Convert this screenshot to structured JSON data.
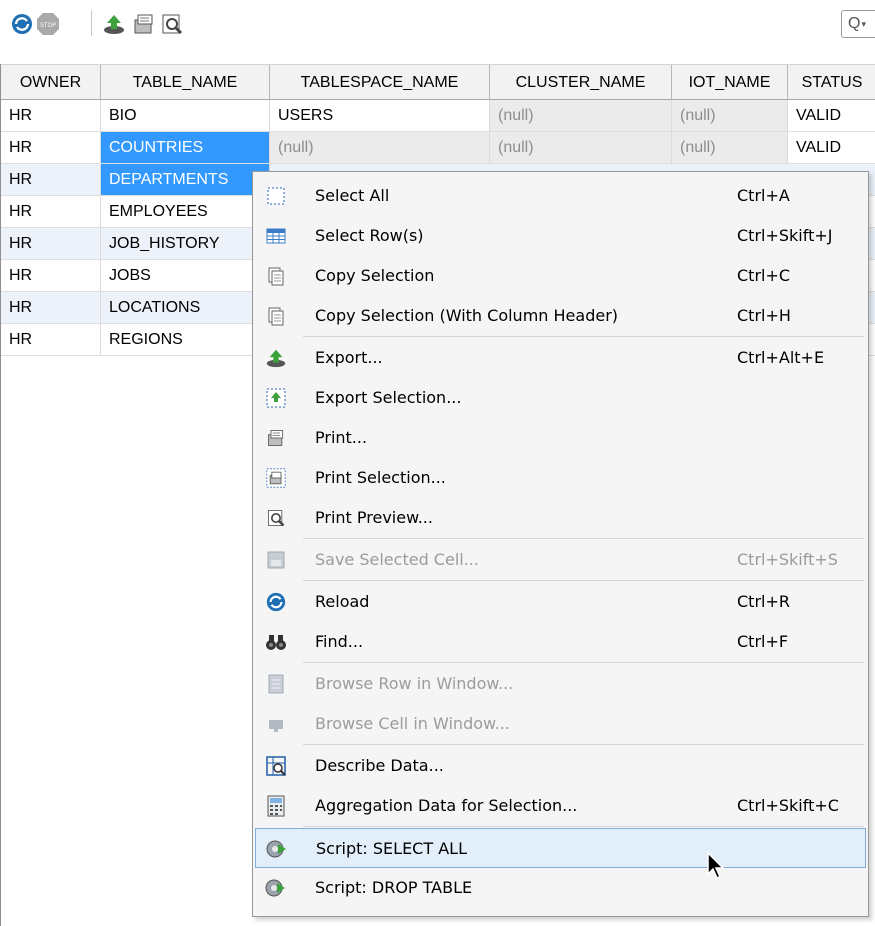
{
  "toolbar": {
    "buttons": [
      {
        "name": "reload-icon"
      },
      {
        "name": "stop-icon",
        "label": "STOP"
      },
      {
        "name": "export-icon"
      },
      {
        "name": "print-icon"
      },
      {
        "name": "print-preview-icon"
      }
    ],
    "search_icon": "Q"
  },
  "grid": {
    "columns": [
      "OWNER",
      "TABLE_NAME",
      "TABLESPACE_NAME",
      "CLUSTER_NAME",
      "IOT_NAME",
      "STATUS"
    ],
    "rows": [
      [
        "HR",
        "BIO",
        "USERS",
        "(null)",
        "(null)",
        "VALID"
      ],
      [
        "HR",
        "COUNTRIES",
        "(null)",
        "(null)",
        "(null)",
        "VALID"
      ],
      [
        "HR",
        "DEPARTMENTS",
        "",
        "",
        "",
        ""
      ],
      [
        "HR",
        "EMPLOYEES",
        "",
        "",
        "",
        ""
      ],
      [
        "HR",
        "JOB_HISTORY",
        "",
        "",
        "",
        ""
      ],
      [
        "HR",
        "JOBS",
        "",
        "",
        "",
        ""
      ],
      [
        "HR",
        "LOCATIONS",
        "",
        "",
        "",
        ""
      ],
      [
        "HR",
        "REGIONS",
        "",
        "",
        "",
        ""
      ]
    ]
  },
  "menu": {
    "items": [
      {
        "label": "Select All",
        "shortcut": "Ctrl+A",
        "icon": "select-all-icon"
      },
      {
        "label": "Select Row(s)",
        "shortcut": "Ctrl+Skift+J",
        "icon": "select-rows-icon"
      },
      {
        "label": "Copy Selection",
        "shortcut": "Ctrl+C",
        "icon": "copy-icon"
      },
      {
        "label": "Copy Selection (With Column Header)",
        "shortcut": "Ctrl+H",
        "icon": "copy-header-icon"
      },
      {
        "label": "Export...",
        "shortcut": "Ctrl+Alt+E",
        "icon": "export-icon"
      },
      {
        "label": "Export Selection...",
        "shortcut": "",
        "icon": "export-selection-icon"
      },
      {
        "label": "Print...",
        "shortcut": "",
        "icon": "print-icon"
      },
      {
        "label": "Print Selection...",
        "shortcut": "",
        "icon": "print-selection-icon"
      },
      {
        "label": "Print Preview...",
        "shortcut": "",
        "icon": "print-preview-icon"
      },
      {
        "label": "Save Selected Cell...",
        "shortcut": "Ctrl+Skift+S",
        "icon": "save-cell-icon",
        "disabled": true
      },
      {
        "label": "Reload",
        "shortcut": "Ctrl+R",
        "icon": "reload-icon"
      },
      {
        "label": "Find...",
        "shortcut": "Ctrl+F",
        "icon": "binoculars-icon"
      },
      {
        "label": "Browse Row in Window...",
        "shortcut": "",
        "icon": "browse-row-icon",
        "disabled": true
      },
      {
        "label": "Browse Cell in Window...",
        "shortcut": "",
        "icon": "browse-cell-icon",
        "disabled": true
      },
      {
        "label": "Describe Data...",
        "shortcut": "",
        "icon": "describe-data-icon"
      },
      {
        "label": "Aggregation Data for Selection...",
        "shortcut": "Ctrl+Skift+C",
        "icon": "calculator-icon"
      },
      {
        "label": "Script: SELECT ALL",
        "shortcut": "",
        "icon": "script-icon",
        "hovered": true
      },
      {
        "label": "Script: DROP TABLE",
        "shortcut": "",
        "icon": "script-icon"
      }
    ]
  },
  "colors": {
    "selection": "#3399ff",
    "null_bg": "#ebebeb",
    "menu_bg": "#f5f5f5",
    "hover_bg": "#e3eefb"
  }
}
